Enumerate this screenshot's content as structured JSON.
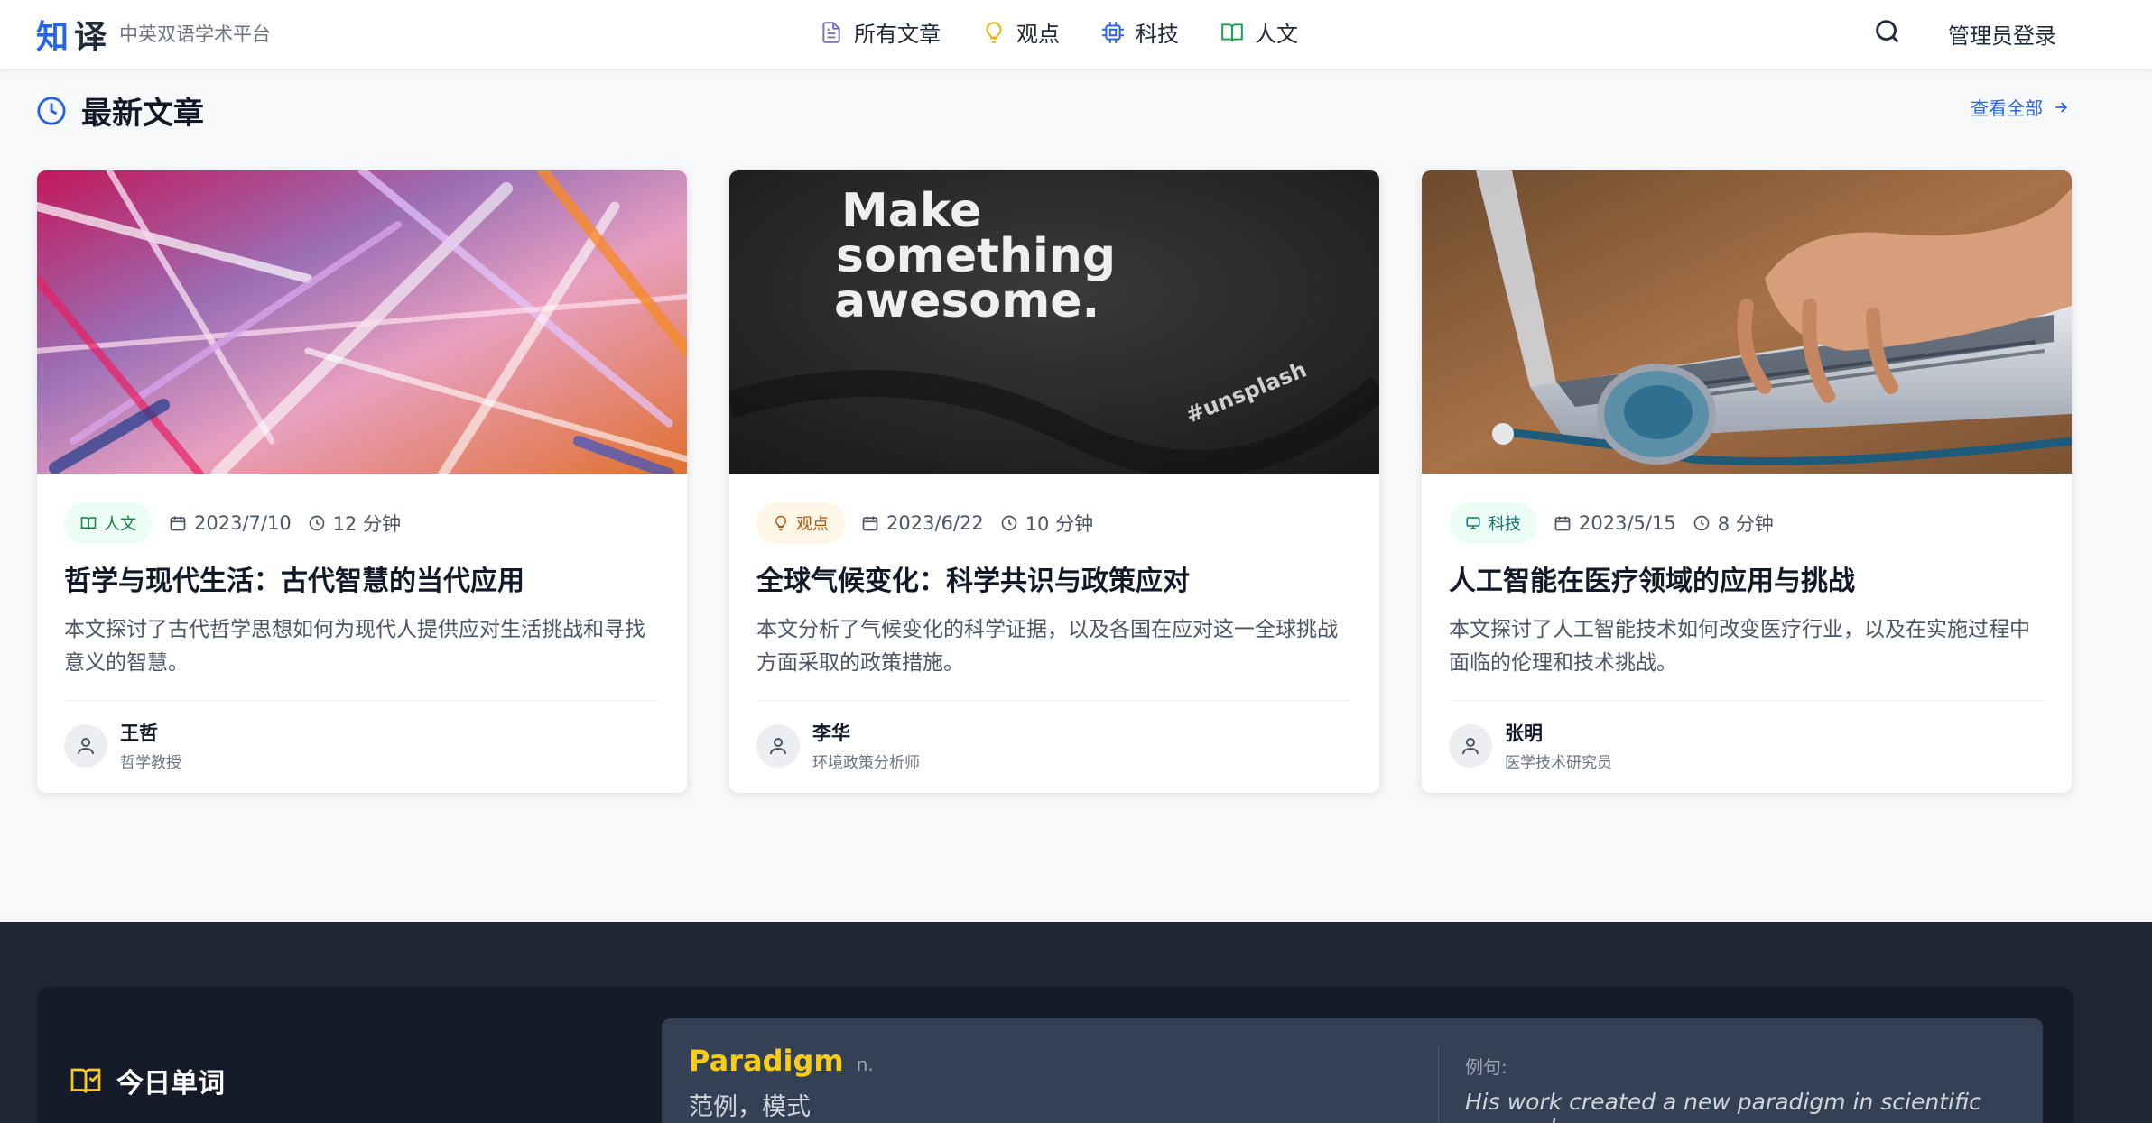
{
  "header": {
    "logo_char1": "知",
    "logo_char2": "译",
    "subtitle": "中英双语学术平台",
    "nav": [
      {
        "label": "所有文章",
        "icon": "document-icon",
        "color": "#7c6fb0"
      },
      {
        "label": "观点",
        "icon": "lightbulb-icon",
        "color": "#eab308"
      },
      {
        "label": "科技",
        "icon": "cpu-icon",
        "color": "#2563eb"
      },
      {
        "label": "人文",
        "icon": "book-icon",
        "color": "#16a34a"
      }
    ],
    "search_icon": "search-icon",
    "login": "管理员登录"
  },
  "latest": {
    "title": "最新文章",
    "view_all": "查看全部"
  },
  "articles": [
    {
      "category": "人文",
      "category_icon": "book-icon",
      "date": "2023/7/10",
      "read_time": "12 分钟",
      "title": "哲学与现代生活：古代智慧的当代应用",
      "desc": "本文探讨了古代哲学思想如何为现代人提供应对生活挑战和寻找意义的智慧。",
      "author": "王哲",
      "role": "哲学教授",
      "image": "abstract-paint-image"
    },
    {
      "category": "观点",
      "category_icon": "lightbulb-icon",
      "date": "2023/6/22",
      "read_time": "10 分钟",
      "title": "全球气候变化：科学共识与政策应对",
      "desc": "本文分析了气候变化的科学证据，以及各国在应对这一全球挑战方面采取的政策措施。",
      "author": "李华",
      "role": "环境政策分析师",
      "image": "make-something-awesome-shirt-image",
      "image_text": [
        "Make",
        "something",
        "awesome."
      ],
      "image_tag": "#unsplash"
    },
    {
      "category": "科技",
      "category_icon": "monitor-icon",
      "date": "2023/5/15",
      "read_time": "8 分钟",
      "title": "人工智能在医疗领域的应用与挑战",
      "desc": "本文探讨了人工智能技术如何改变医疗行业，以及在实施过程中面临的伦理和技术挑战。",
      "author": "张明",
      "role": "医学技术研究员",
      "image": "laptop-stethoscope-image"
    }
  ],
  "word_of_day": {
    "label": "今日单词",
    "term": "Paradigm",
    "pos": "n.",
    "meaning": "范例，模式",
    "example_label": "例句:",
    "example": "His work created a new paradigm in scientific research."
  },
  "colors": {
    "accent": "#2563eb",
    "footer_bg": "#1e2534",
    "word_highlight": "#facc15"
  }
}
